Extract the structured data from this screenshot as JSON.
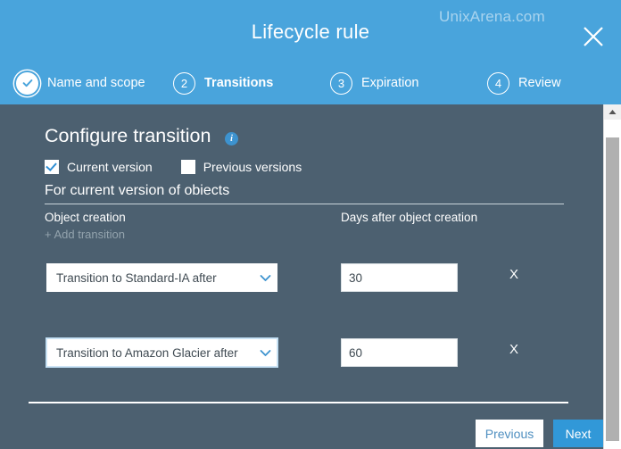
{
  "header": {
    "title": "Lifecycle rule",
    "watermark": "UnixArena.com",
    "close_icon": "close-icon",
    "bg_color": "#49a4dc"
  },
  "steps": [
    {
      "number": "1",
      "label": "Name and scope",
      "state": "done"
    },
    {
      "number": "2",
      "label": "Transitions",
      "state": "active"
    },
    {
      "number": "3",
      "label": "Expiration",
      "state": "upcoming"
    },
    {
      "number": "4",
      "label": "Review",
      "state": "upcoming"
    }
  ],
  "main": {
    "section_title": "Configure transition",
    "info_icon": "info-icon",
    "info_glyph": "i",
    "checkboxes": [
      {
        "label": "Current version",
        "checked": true
      },
      {
        "label": "Previous versions",
        "checked": false
      }
    ],
    "subsection_title": "For current version of obiects",
    "column_headers": {
      "left": "Object creation",
      "right": "Days after object creation"
    },
    "add_transition_label": "+ Add transition",
    "transitions": [
      {
        "select_value": "Transition to Standard-IA after",
        "days": "30",
        "remove_label": "X",
        "focused": false
      },
      {
        "select_value": "Transition to Amazon Glacier after",
        "days": "60",
        "remove_label": "X",
        "focused": true
      }
    ]
  },
  "footer": {
    "previous_label": "Previous",
    "next_label": "Next"
  },
  "scrollbar": {
    "up_arrow_icon": "scroll-up-arrow-icon"
  },
  "colors": {
    "header_blue": "#49a4dc",
    "body_slate": "#4c6070",
    "accent_blue": "#3198d8",
    "muted_text": "#93a3ad"
  }
}
